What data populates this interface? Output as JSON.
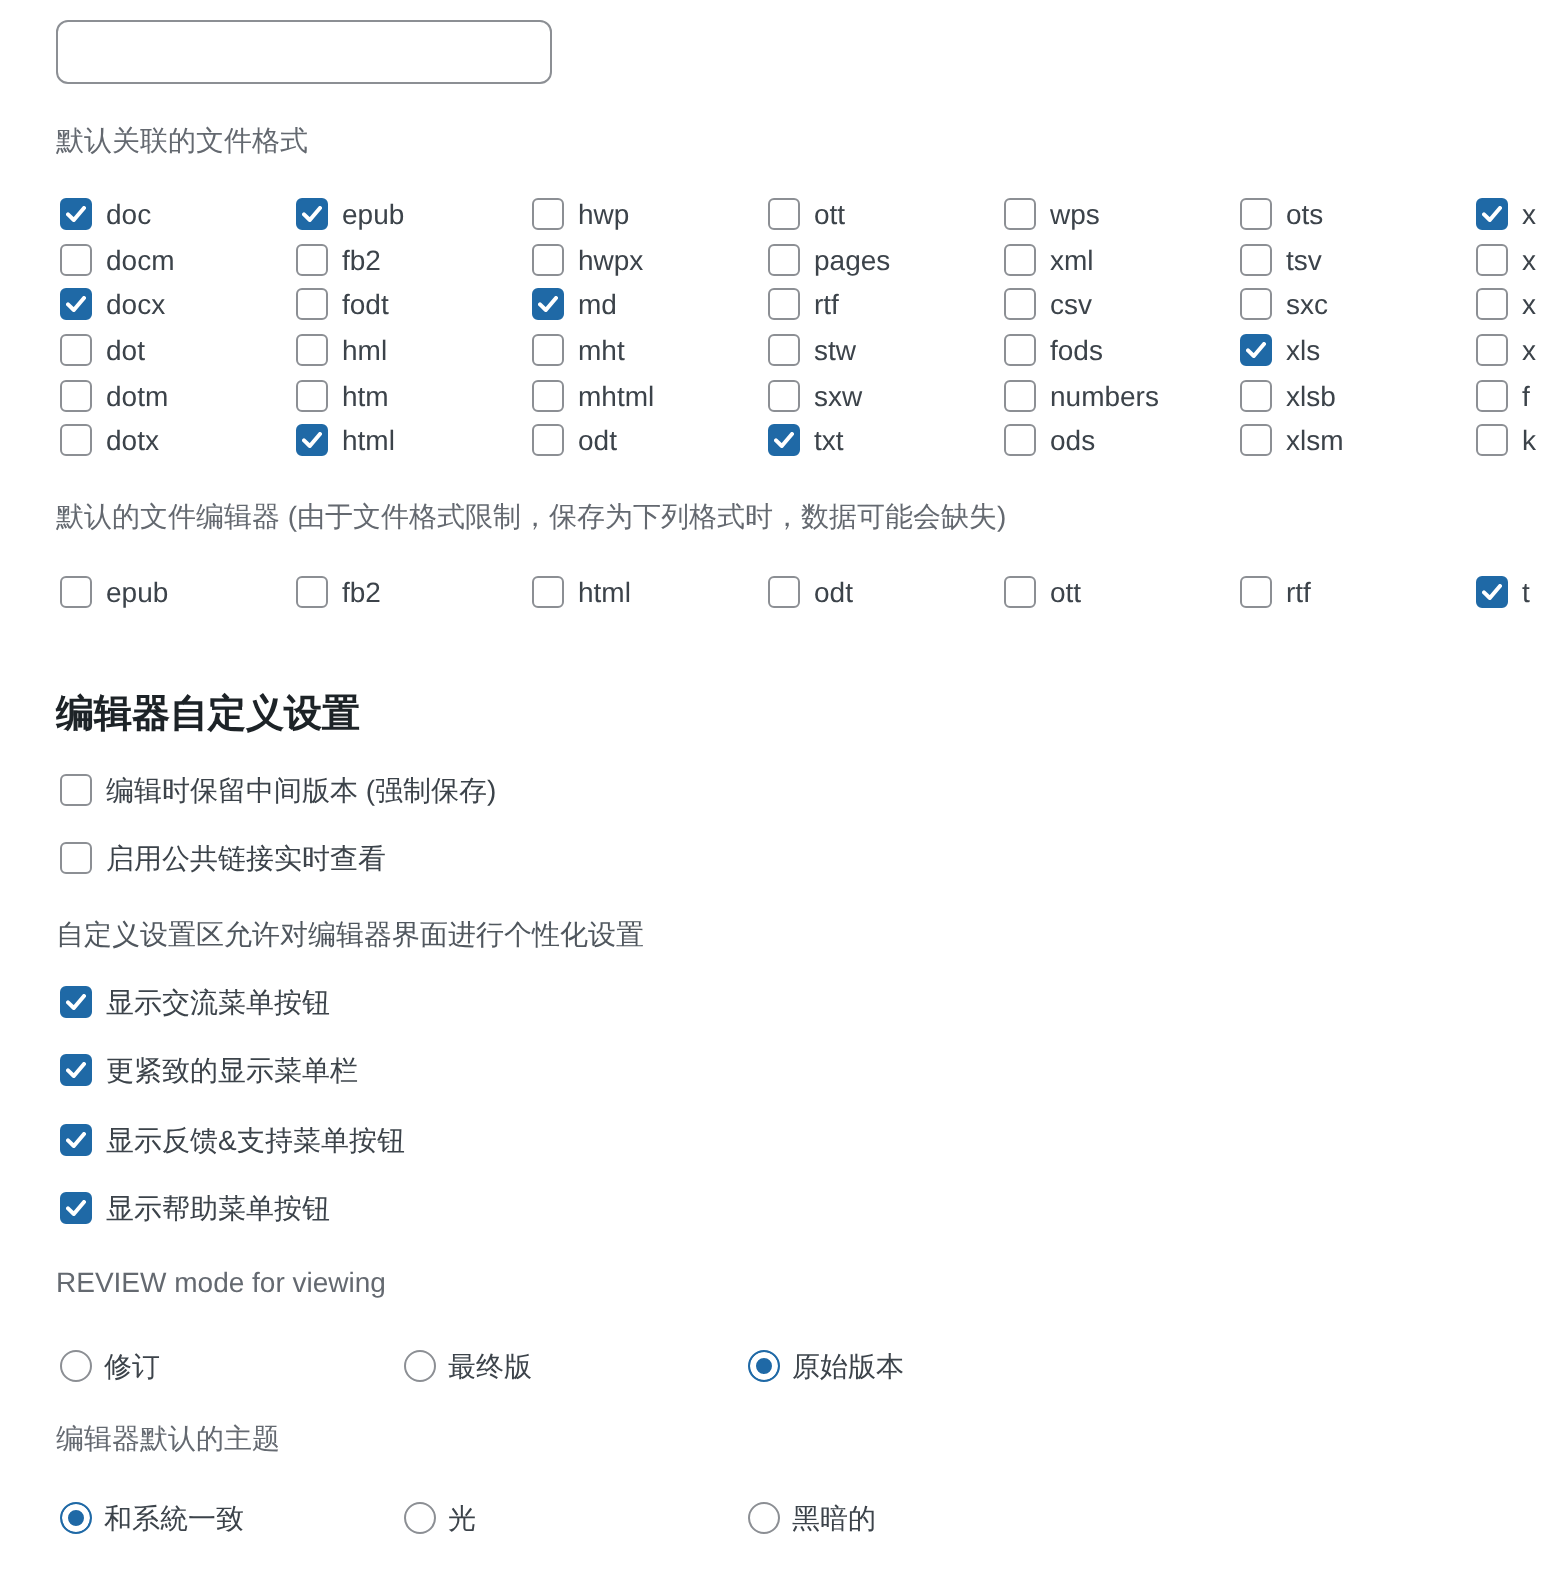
{
  "associated_formats": {
    "label": "默认关联的文件格式",
    "options": [
      {
        "label": "doc",
        "checked": true
      },
      {
        "label": "docm",
        "checked": false
      },
      {
        "label": "docx",
        "checked": true
      },
      {
        "label": "dot",
        "checked": false
      },
      {
        "label": "dotm",
        "checked": false
      },
      {
        "label": "dotx",
        "checked": false
      },
      {
        "label": "epub",
        "checked": true
      },
      {
        "label": "fb2",
        "checked": false
      },
      {
        "label": "fodt",
        "checked": false
      },
      {
        "label": "hml",
        "checked": false
      },
      {
        "label": "htm",
        "checked": false
      },
      {
        "label": "html",
        "checked": true
      },
      {
        "label": "hwp",
        "checked": false
      },
      {
        "label": "hwpx",
        "checked": false
      },
      {
        "label": "md",
        "checked": true
      },
      {
        "label": "mht",
        "checked": false
      },
      {
        "label": "mhtml",
        "checked": false
      },
      {
        "label": "odt",
        "checked": false
      },
      {
        "label": "ott",
        "checked": false
      },
      {
        "label": "pages",
        "checked": false
      },
      {
        "label": "rtf",
        "checked": false
      },
      {
        "label": "stw",
        "checked": false
      },
      {
        "label": "sxw",
        "checked": false
      },
      {
        "label": "txt",
        "checked": true
      },
      {
        "label": "wps",
        "checked": false
      },
      {
        "label": "xml",
        "checked": false
      },
      {
        "label": "csv",
        "checked": false
      },
      {
        "label": "fods",
        "checked": false
      },
      {
        "label": "numbers",
        "checked": false
      },
      {
        "label": "ods",
        "checked": false
      },
      {
        "label": "ots",
        "checked": false
      },
      {
        "label": "tsv",
        "checked": false
      },
      {
        "label": "sxc",
        "checked": false
      },
      {
        "label": "xls",
        "checked": true
      },
      {
        "label": "xlsb",
        "checked": false
      },
      {
        "label": "xlsm",
        "checked": false
      },
      {
        "label": "x",
        "checked": true
      },
      {
        "label": "x",
        "checked": false
      },
      {
        "label": "x",
        "checked": false
      },
      {
        "label": "x",
        "checked": false
      },
      {
        "label": "f",
        "checked": false
      },
      {
        "label": "k",
        "checked": false
      }
    ]
  },
  "default_editor_formats": {
    "label": "默认的文件编辑器 (由于文件格式限制，保存为下列格式时，数据可能会缺失)",
    "options": [
      {
        "label": "epub",
        "checked": false
      },
      {
        "label": "fb2",
        "checked": false
      },
      {
        "label": "html",
        "checked": false
      },
      {
        "label": "odt",
        "checked": false
      },
      {
        "label": "ott",
        "checked": false
      },
      {
        "label": "rtf",
        "checked": false
      },
      {
        "label": "t",
        "checked": true
      }
    ]
  },
  "editor_customization": {
    "title": "编辑器自定义设置",
    "options": [
      {
        "label": "编辑时保留中间版本 (强制保存)",
        "checked": false
      },
      {
        "label": "启用公共链接实时查看",
        "checked": false
      }
    ],
    "note": "自定义设置区允许对编辑器界面进行个性化设置",
    "interface_options": [
      {
        "label": "显示交流菜单按钮",
        "checked": true
      },
      {
        "label": "更紧致的显示菜单栏",
        "checked": true
      },
      {
        "label": "显示反馈&支持菜单按钮",
        "checked": true
      },
      {
        "label": "显示帮助菜单按钮",
        "checked": true
      }
    ]
  },
  "review_mode": {
    "label": "REVIEW mode for viewing",
    "options": [
      {
        "label": "修订",
        "selected": false
      },
      {
        "label": "最终版",
        "selected": false
      },
      {
        "label": "原始版本",
        "selected": true
      }
    ]
  },
  "default_theme": {
    "label": "编辑器默认的主题",
    "options": [
      {
        "label": "和系統一致",
        "selected": true
      },
      {
        "label": "光",
        "selected": false
      },
      {
        "label": "黑暗的",
        "selected": false
      }
    ]
  }
}
